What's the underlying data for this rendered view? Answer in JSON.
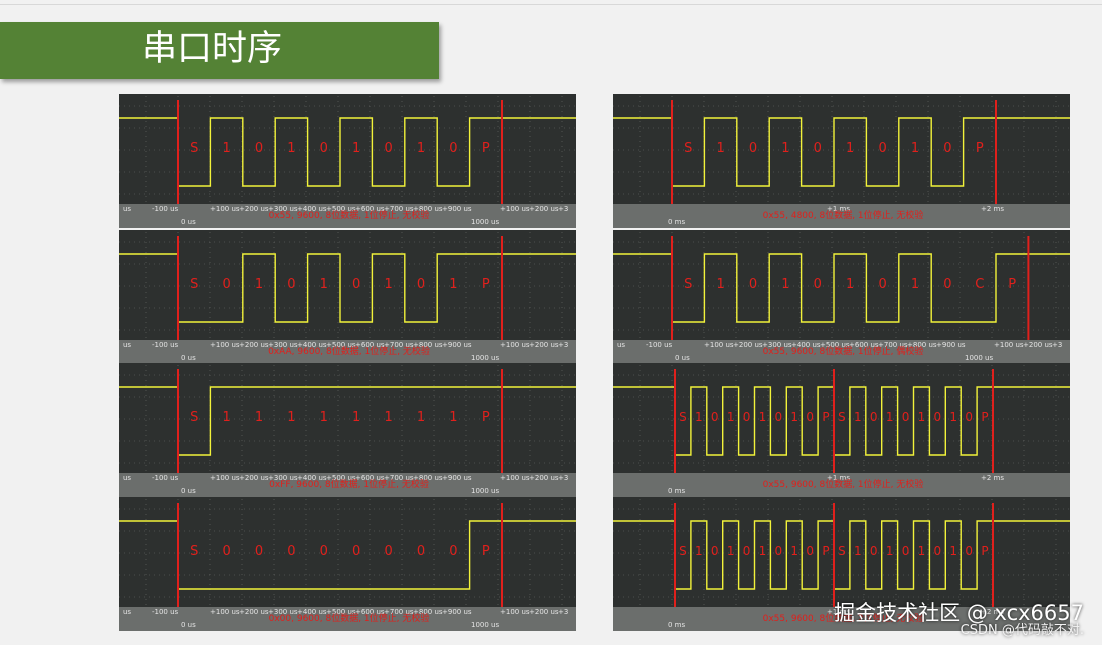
{
  "slide": {
    "title": "串口时序"
  },
  "colors": {
    "banner": "#548235",
    "trace": "#f2f23a",
    "marker": "#e0201c",
    "screen": "#2d302f",
    "axis_bar": "#6b6e6c"
  },
  "panels": [
    {
      "id": "left-1",
      "labels": [
        "S",
        "1",
        "0",
        "1",
        "0",
        "1",
        "0",
        "1",
        "0",
        "P"
      ],
      "bits": [
        1,
        0,
        1,
        0,
        1,
        0,
        1,
        0
      ],
      "stop_bits": 1,
      "caption": "0x55, 9600, 8位数据, 1位停止, 无校验",
      "ticks": [
        "us",
        "-100 us",
        "0 us",
        "+100 us",
        "+200 us",
        "+300 us",
        "+400 us",
        "+500 us",
        "+600 us",
        "+700 us",
        "+800 us",
        "+900 us",
        "1000 us",
        "+100 us",
        "+200 us",
        "+3"
      ]
    },
    {
      "id": "right-1",
      "labels": [
        "S",
        "1",
        "0",
        "1",
        "0",
        "1",
        "0",
        "1",
        "0",
        "P"
      ],
      "bits": [
        1,
        0,
        1,
        0,
        1,
        0,
        1,
        0
      ],
      "stop_bits": 1,
      "caption": "0x55, 4800, 8位数据, 1位停止, 无校验",
      "ticks": [
        "0 ms",
        "+1 ms",
        "+2 ms"
      ]
    },
    {
      "id": "left-2",
      "labels": [
        "S",
        "0",
        "1",
        "0",
        "1",
        "0",
        "1",
        "0",
        "1",
        "P"
      ],
      "bits": [
        0,
        1,
        0,
        1,
        0,
        1,
        0,
        1
      ],
      "stop_bits": 1,
      "caption": "0xAA, 9600, 8位数据, 1位停止, 无校验",
      "ticks": [
        "us",
        "-100 us",
        "0 us",
        "+100 us",
        "+200 us",
        "+300 us",
        "+400 us",
        "+500 us",
        "+600 us",
        "+700 us",
        "+800 us",
        "+900 us",
        "1000 us",
        "+100 us",
        "+200 us",
        "+3"
      ]
    },
    {
      "id": "right-2",
      "labels": [
        "S",
        "1",
        "0",
        "1",
        "0",
        "1",
        "0",
        "1",
        "0",
        "C",
        "P"
      ],
      "bits": [
        1,
        0,
        1,
        0,
        1,
        0,
        1,
        0,
        0
      ],
      "stop_bits": 1,
      "caption": "0x55, 9600, 8位数据, 1位停止, 偶校验",
      "ticks": [
        "us",
        "-100 us",
        "0 us",
        "+100 us",
        "+200 us",
        "+300 us",
        "+400 us",
        "+500 us",
        "+600 us",
        "+700 us",
        "+800 us",
        "+900 us",
        "1000 us",
        "+100 us",
        "+200 us",
        "+3"
      ]
    },
    {
      "id": "left-3",
      "labels": [
        "S",
        "1",
        "1",
        "1",
        "1",
        "1",
        "1",
        "1",
        "1",
        "P"
      ],
      "bits": [
        1,
        1,
        1,
        1,
        1,
        1,
        1,
        1
      ],
      "stop_bits": 1,
      "caption": "0xFF, 9600, 8位数据, 1位停止, 无校验",
      "ticks": [
        "us",
        "-100 us",
        "0 us",
        "+100 us",
        "+200 us",
        "+300 us",
        "+400 us",
        "+500 us",
        "+600 us",
        "+700 us",
        "+800 us",
        "+900 us",
        "1000 us",
        "+100 us",
        "+200 us",
        "+3"
      ]
    },
    {
      "id": "right-3",
      "labels": [
        "S",
        "1",
        "0",
        "1",
        "0",
        "1",
        "0",
        "1",
        "0",
        "P",
        "S",
        "1",
        "0",
        "1",
        "0",
        "1",
        "0",
        "1",
        "0",
        "P"
      ],
      "bits": [
        1,
        0,
        1,
        0,
        1,
        0,
        1,
        0
      ],
      "frames": 2,
      "stop_bits": 1,
      "caption": "0x55, 9600, 8位数据, 1位停止, 无校验",
      "ticks": [
        "0 ms",
        "+1 ms",
        "+2 ms"
      ]
    },
    {
      "id": "left-4",
      "labels": [
        "S",
        "0",
        "0",
        "0",
        "0",
        "0",
        "0",
        "0",
        "0",
        "P"
      ],
      "bits": [
        0,
        0,
        0,
        0,
        0,
        0,
        0,
        0
      ],
      "stop_bits": 1,
      "caption": "0x00, 9600, 8位数据, 1位停止, 无校验",
      "ticks": [
        "us",
        "-100 us",
        "0 us",
        "+100 us",
        "+200 us",
        "+300 us",
        "+400 us",
        "+500 us",
        "+600 us",
        "+700 us",
        "+800 us",
        "+900 us",
        "1000 us",
        "+100 us",
        "+200 us",
        "+3"
      ]
    },
    {
      "id": "right-4",
      "labels": [
        "S",
        "1",
        "0",
        "1",
        "0",
        "1",
        "0",
        "1",
        "0",
        "P",
        "S",
        "1",
        "0",
        "1",
        "0",
        "1",
        "0",
        "1",
        "0",
        "P"
      ],
      "bits": [
        1,
        0,
        1,
        0,
        1,
        0,
        1,
        0
      ],
      "frames": 2,
      "stop_bits": 2,
      "caption": "0x55, 9600, 8位数据, 2位停止, 无校验",
      "ticks": [
        "0 ms",
        "+1 ms",
        "+2 ms"
      ]
    }
  ],
  "watermark": {
    "line1": "掘金技术社区 @ xcx6657",
    "line2": "CSDN @代码敲不对."
  }
}
